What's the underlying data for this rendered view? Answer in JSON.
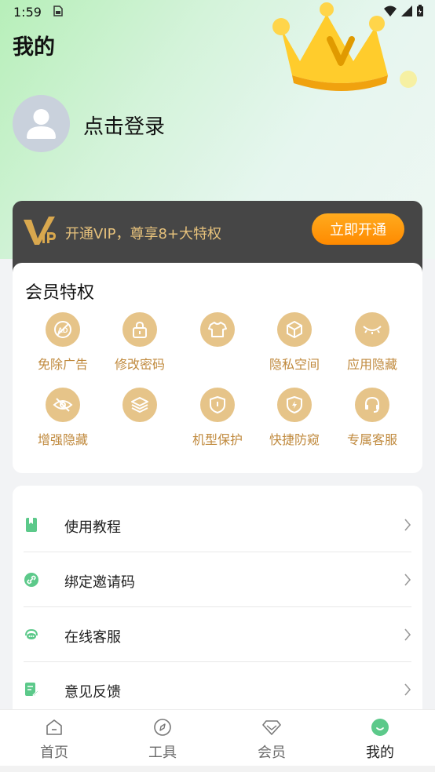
{
  "status_bar": {
    "time": "1:59"
  },
  "header": {
    "title": "我的"
  },
  "profile": {
    "login_text": "点击登录"
  },
  "vip_banner": {
    "text": "开通VIP，尊享8+大特权",
    "button_label": "立即开通"
  },
  "privileges": {
    "title": "会员特权",
    "items": [
      {
        "label": "免除广告",
        "icon": "no-ads-icon"
      },
      {
        "label": "修改密码",
        "icon": "lock-icon"
      },
      {
        "label": "",
        "icon": "shirt-icon"
      },
      {
        "label": "隐私空间",
        "icon": "box-icon"
      },
      {
        "label": "应用隐藏",
        "icon": "closed-eye-icon"
      },
      {
        "label": "增强隐藏",
        "icon": "eye-off-icon"
      },
      {
        "label": "",
        "icon": "layers-icon"
      },
      {
        "label": "机型保护",
        "icon": "shield-icon"
      },
      {
        "label": "快捷防窥",
        "icon": "flash-shield-icon"
      },
      {
        "label": "专属客服",
        "icon": "headset-icon"
      }
    ]
  },
  "menu": {
    "items": [
      {
        "label": "使用教程",
        "icon": "book-icon"
      },
      {
        "label": "绑定邀请码",
        "icon": "link-icon"
      },
      {
        "label": "在线客服",
        "icon": "chat-icon"
      },
      {
        "label": "意见反馈",
        "icon": "feedback-icon"
      }
    ]
  },
  "tabbar": {
    "items": [
      {
        "label": "首页",
        "icon": "home-icon"
      },
      {
        "label": "工具",
        "icon": "compass-icon"
      },
      {
        "label": "会员",
        "icon": "diamond-icon"
      },
      {
        "label": "我的",
        "icon": "profile-icon"
      }
    ],
    "active": "我的"
  },
  "colors": {
    "accent_green": "#5cc98a",
    "gold": "#e6c489",
    "gold_text": "#c08a3e",
    "vip_button": "#ff9500"
  }
}
